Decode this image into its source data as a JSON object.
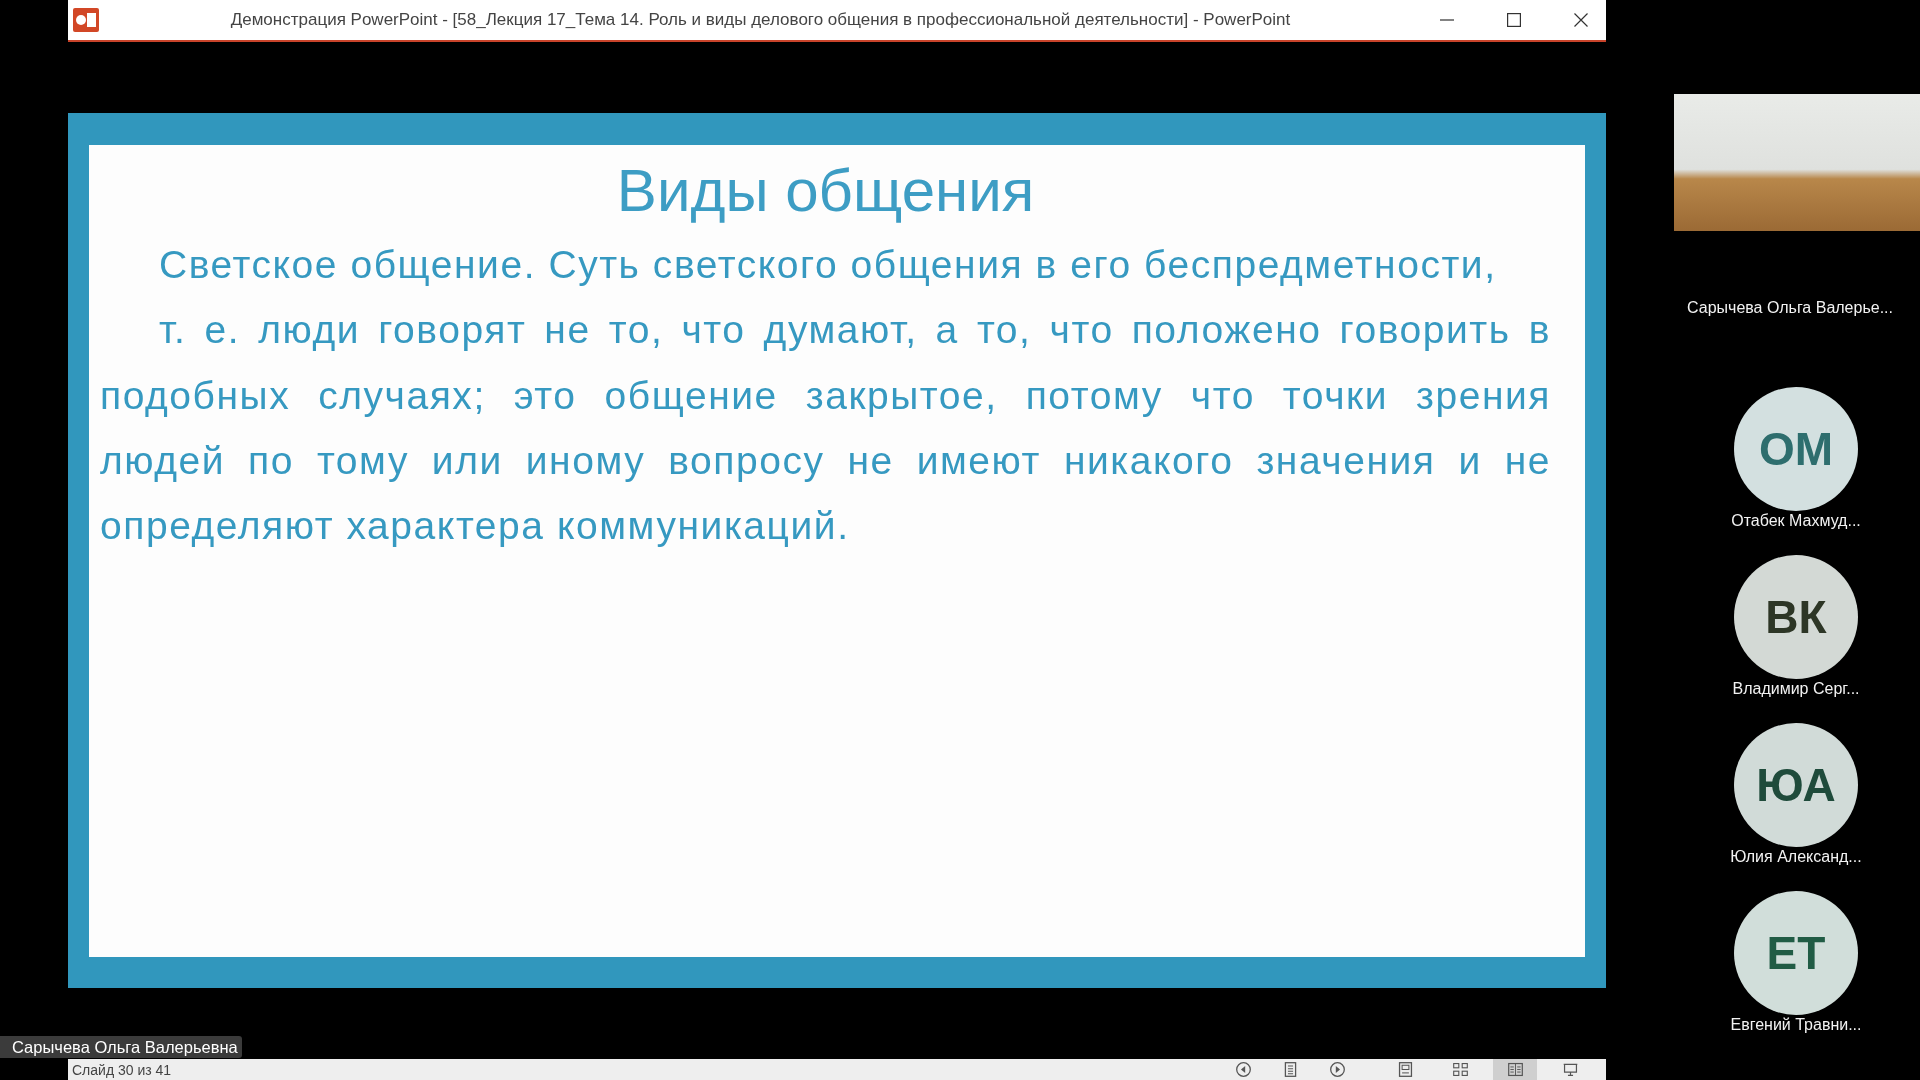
{
  "window": {
    "title": "Демонстрация PowerPoint - [58_Лекция 17_Тема 14. Роль и виды делового общения в профессиональной деятельности] - PowerPoint"
  },
  "slide": {
    "title": "Виды общения",
    "paragraphs": [
      "Светское общение. Суть светского общения в его беспредметности,",
      "т. е. люди говорят не то, что думают, а то, что положено говорить в подобных случаях; это общение закрытое, потому что точки зрения людей по тому или иному вопросу не имеют никакого значения и не определяют характера коммуникаций."
    ]
  },
  "status_bar": {
    "text": "Слайд 30 из 41",
    "nav_buttons": [
      {
        "kind": "previous"
      },
      {
        "kind": "notes"
      },
      {
        "kind": "next"
      }
    ],
    "view_buttons": [
      {
        "kind": "normal",
        "selected": false
      },
      {
        "kind": "sorter",
        "selected": false
      },
      {
        "kind": "reading",
        "selected": true
      },
      {
        "kind": "slideshow",
        "selected": false
      }
    ]
  },
  "presenter_tag": "Сарычева Ольга Валерьевна",
  "participants": [
    {
      "kind": "video",
      "name": "Сарычева Ольга Валерье..."
    },
    {
      "kind": "avatar",
      "initials": "ОМ",
      "name": "Отабек Махмуд...",
      "color": "#2e6e6e"
    },
    {
      "kind": "avatar",
      "initials": "ВК",
      "name": "Владимир Серг...",
      "color": "#2d3626"
    },
    {
      "kind": "avatar",
      "initials": "ЮА",
      "name": "Юлия Александ...",
      "color": "#1f4b3b"
    },
    {
      "kind": "avatar",
      "initials": "ЕТ",
      "name": "Евгений Травни...",
      "color": "#215c45"
    }
  ]
}
